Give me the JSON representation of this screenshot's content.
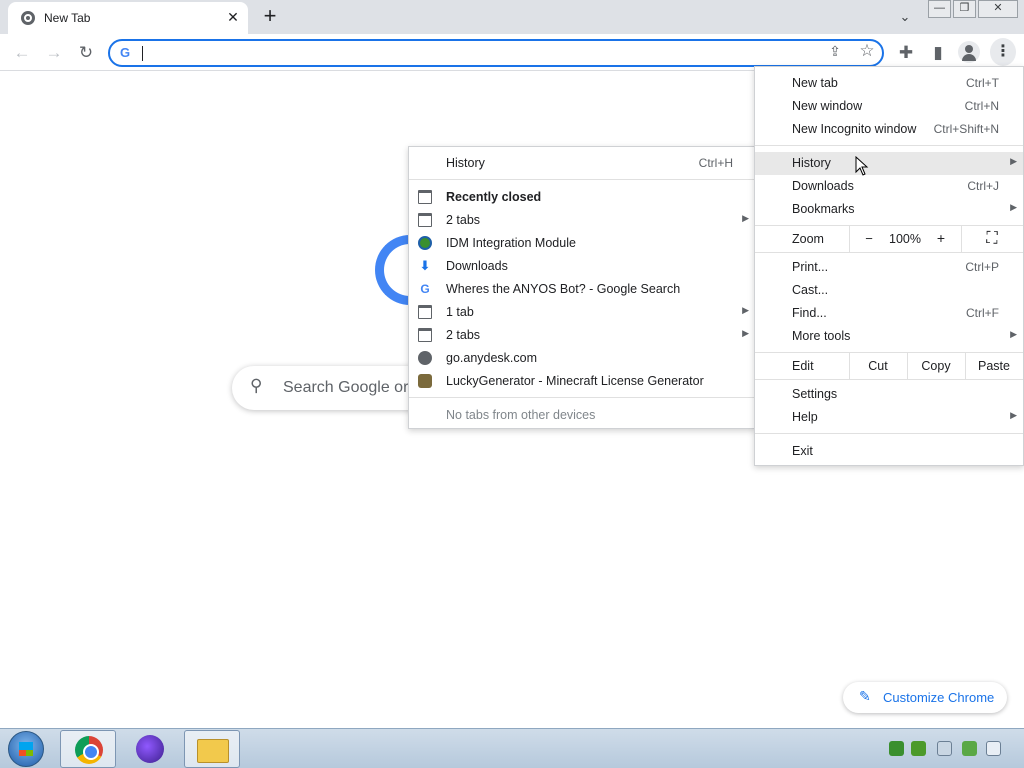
{
  "browser": {
    "tab_title": "New Tab",
    "tab_close": "✕",
    "new_tab_glyph": "+",
    "tab_search_glyph": "⌄",
    "window_controls": {
      "minimize": "—",
      "restore": "❐",
      "close": "✕"
    }
  },
  "toolbar": {
    "back_glyph": "←",
    "forward_glyph": "→",
    "reload_glyph": "↻",
    "omnibox_g": "G",
    "omnibox_value": "",
    "share_glyph": "⇪",
    "star_glyph": "☆",
    "extensions_glyph": "✚",
    "sidepanel_glyph": "▮",
    "menu_glyph": "⋮"
  },
  "page": {
    "search_placeholder": "Search Google or",
    "search_glyph": "⚲",
    "customize_label": "Customize Chrome",
    "customize_glyph": "✎"
  },
  "main_menu": {
    "new_tab": {
      "label": "New tab",
      "shortcut": "Ctrl+T"
    },
    "new_window": {
      "label": "New window",
      "shortcut": "Ctrl+N"
    },
    "new_incognito": {
      "label": "New Incognito window",
      "shortcut": "Ctrl+Shift+N"
    },
    "history": {
      "label": "History"
    },
    "downloads": {
      "label": "Downloads",
      "shortcut": "Ctrl+J"
    },
    "bookmarks": {
      "label": "Bookmarks"
    },
    "zoom": {
      "label": "Zoom",
      "minus": "−",
      "value": "100%",
      "plus": "+",
      "fullscreen": "⛶"
    },
    "print": {
      "label": "Print...",
      "shortcut": "Ctrl+P"
    },
    "cast": {
      "label": "Cast..."
    },
    "find": {
      "label": "Find...",
      "shortcut": "Ctrl+F"
    },
    "more_tools": {
      "label": "More tools"
    },
    "edit": {
      "label": "Edit",
      "cut": "Cut",
      "copy": "Copy",
      "paste": "Paste"
    },
    "settings": {
      "label": "Settings"
    },
    "help": {
      "label": "Help"
    },
    "exit": {
      "label": "Exit"
    },
    "arrow": "▶"
  },
  "history_menu": {
    "history": {
      "label": "History",
      "shortcut": "Ctrl+H"
    },
    "recently_closed": "Recently closed",
    "items": [
      {
        "label": "2 tabs",
        "icon": "tab-icon",
        "has_submenu": true
      },
      {
        "label": "IDM Integration Module",
        "icon": "idm-icon",
        "has_submenu": false
      },
      {
        "label": "Downloads",
        "icon": "download-icon",
        "has_submenu": false
      },
      {
        "label": "Wheres the ANYOS Bot? - Google Search",
        "icon": "google-icon",
        "has_submenu": false
      },
      {
        "label": "1 tab",
        "icon": "tab-icon",
        "has_submenu": true
      },
      {
        "label": "2 tabs",
        "icon": "tab-icon",
        "has_submenu": true
      },
      {
        "label": "go.anydesk.com",
        "icon": "globe-icon",
        "has_submenu": false
      },
      {
        "label": "LuckyGenerator - Minecraft License Generator",
        "icon": "lucky-icon",
        "has_submenu": false
      }
    ],
    "no_tabs": "No tabs from other devices",
    "download_glyph": "⬇",
    "google_glyph": "G",
    "arrow": "▶"
  }
}
